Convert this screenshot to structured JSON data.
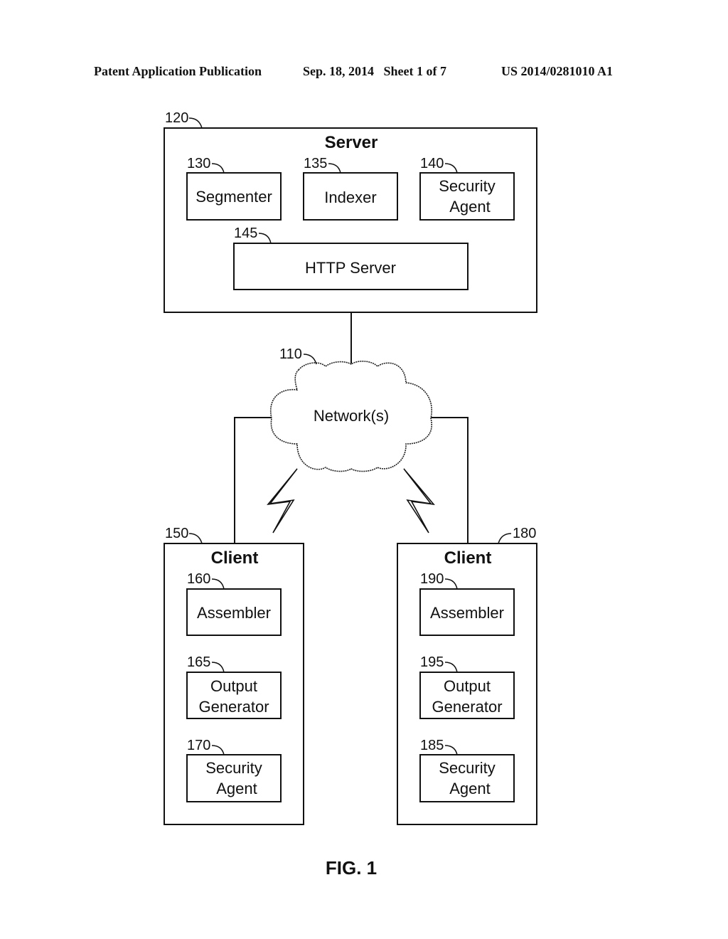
{
  "header": {
    "publication": "Patent Application Publication",
    "date_sheet": "Sep. 18, 2014   Sheet 1 of 7",
    "patent_number": "US 2014/0281010 A1"
  },
  "server": {
    "ref": "120",
    "title": "Server",
    "components": [
      {
        "ref": "130",
        "lines": [
          "Segmenter"
        ]
      },
      {
        "ref": "135",
        "lines": [
          "Indexer"
        ]
      },
      {
        "ref": "140",
        "lines": [
          "Security",
          "Agent"
        ]
      },
      {
        "ref": "145",
        "lines": [
          "HTTP Server"
        ]
      }
    ]
  },
  "network": {
    "ref": "110",
    "label": "Network(s)"
  },
  "clients": [
    {
      "ref": "150",
      "title": "Client",
      "components": [
        {
          "ref": "160",
          "lines": [
            "Assembler"
          ]
        },
        {
          "ref": "165",
          "lines": [
            "Output",
            "Generator"
          ]
        },
        {
          "ref": "170",
          "lines": [
            "Security",
            "Agent"
          ]
        }
      ]
    },
    {
      "ref": "180",
      "title": "Client",
      "components": [
        {
          "ref": "190",
          "lines": [
            "Assembler"
          ]
        },
        {
          "ref": "195",
          "lines": [
            "Output",
            "Generator"
          ]
        },
        {
          "ref": "185",
          "lines": [
            "Security",
            "Agent"
          ]
        }
      ]
    }
  ],
  "figure_label": "FIG. 1"
}
